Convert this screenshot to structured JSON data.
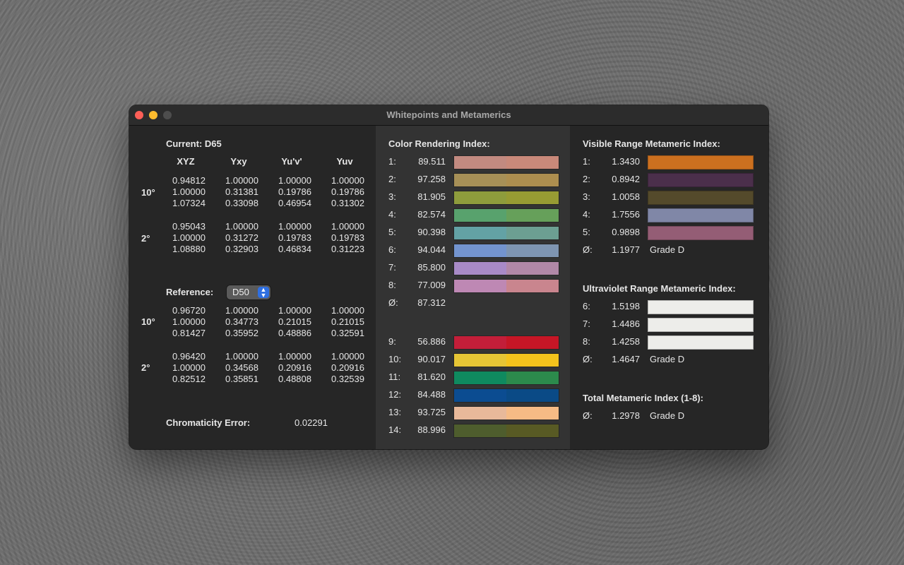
{
  "window": {
    "title": "Whitepoints and Metamerics"
  },
  "left": {
    "current_label": "Current: D65",
    "columns": [
      "XYZ",
      "Yxy",
      "Yu'v'",
      "Yuv"
    ],
    "current": {
      "obs10": {
        "label": "10°",
        "rows": [
          [
            "0.94812",
            "1.00000",
            "1.00000",
            "1.00000"
          ],
          [
            "1.00000",
            "0.31381",
            "0.19786",
            "0.19786"
          ],
          [
            "1.07324",
            "0.33098",
            "0.46954",
            "0.31302"
          ]
        ]
      },
      "obs2": {
        "label": "2°",
        "rows": [
          [
            "0.95043",
            "1.00000",
            "1.00000",
            "1.00000"
          ],
          [
            "1.00000",
            "0.31272",
            "0.19783",
            "0.19783"
          ],
          [
            "1.08880",
            "0.32903",
            "0.46834",
            "0.31223"
          ]
        ]
      }
    },
    "reference_label": "Reference:",
    "reference_value": "D50",
    "reference": {
      "obs10": {
        "label": "10°",
        "rows": [
          [
            "0.96720",
            "1.00000",
            "1.00000",
            "1.00000"
          ],
          [
            "1.00000",
            "0.34773",
            "0.21015",
            "0.21015"
          ],
          [
            "0.81427",
            "0.35952",
            "0.48886",
            "0.32591"
          ]
        ]
      },
      "obs2": {
        "label": "2°",
        "rows": [
          [
            "0.96420",
            "1.00000",
            "1.00000",
            "1.00000"
          ],
          [
            "1.00000",
            "0.34568",
            "0.20916",
            "0.20916"
          ],
          [
            "0.82512",
            "0.35851",
            "0.48808",
            "0.32539"
          ]
        ]
      }
    },
    "chromaticity_label": "Chromaticity Error:",
    "chromaticity_value": "0.02291"
  },
  "cri": {
    "heading": "Color Rendering Index:",
    "items": [
      {
        "label": "1:",
        "value": "89.511",
        "c1": "#c28a80",
        "c2": "#c9897a"
      },
      {
        "label": "2:",
        "value": "97.258",
        "c1": "#a79057",
        "c2": "#ad8e4f"
      },
      {
        "label": "3:",
        "value": "81.905",
        "c1": "#8e9c3c",
        "c2": "#979b33"
      },
      {
        "label": "4:",
        "value": "82.574",
        "c1": "#58a26d",
        "c2": "#66a05a"
      },
      {
        "label": "5:",
        "value": "90.398",
        "c1": "#63a2a5",
        "c2": "#6c9f92"
      },
      {
        "label": "6:",
        "value": "94.044",
        "c1": "#7394cf",
        "c2": "#7e95b2"
      },
      {
        "label": "7:",
        "value": "85.800",
        "c1": "#a88ac7",
        "c2": "#b188a7"
      },
      {
        "label": "8:",
        "value": "77.009",
        "c1": "#be88b4",
        "c2": "#c9858e"
      }
    ],
    "avg_label": "Ø:",
    "avg_value": "87.312",
    "items2": [
      {
        "label": "9:",
        "value": "56.886",
        "c1": "#c31e39",
        "c2": "#c61626"
      },
      {
        "label": "10:",
        "value": "90.017",
        "c1": "#e6c535",
        "c2": "#f4c31c"
      },
      {
        "label": "11:",
        "value": "81.620",
        "c1": "#0f8a5f",
        "c2": "#2c8a4c"
      },
      {
        "label": "12:",
        "value": "84.488",
        "c1": "#0b4c91",
        "c2": "#0a4a86"
      },
      {
        "label": "13:",
        "value": "93.725",
        "c1": "#e8b99a",
        "c2": "#f6bb85"
      },
      {
        "label": "14:",
        "value": "88.996",
        "c1": "#4e5d2d",
        "c2": "#585a24"
      }
    ]
  },
  "visible_mi": {
    "heading": "Visible Range Metameric Index:",
    "items": [
      {
        "label": "1:",
        "value": "1.3430",
        "color": "#cc701f"
      },
      {
        "label": "2:",
        "value": "0.8942",
        "color": "#4b2f4b"
      },
      {
        "label": "3:",
        "value": "1.0058",
        "color": "#544a2b"
      },
      {
        "label": "4:",
        "value": "1.7556",
        "color": "#8087a7"
      },
      {
        "label": "5:",
        "value": "0.9898",
        "color": "#945d75"
      }
    ],
    "avg_label": "Ø:",
    "avg_value": "1.1977",
    "grade": "Grade D"
  },
  "uv_mi": {
    "heading": "Ultraviolet Range Metameric Index:",
    "items": [
      {
        "label": "6:",
        "value": "1.5198",
        "color": "#ededea"
      },
      {
        "label": "7:",
        "value": "1.4486",
        "color": "#ededea"
      },
      {
        "label": "8:",
        "value": "1.4258",
        "color": "#ededea"
      }
    ],
    "avg_label": "Ø:",
    "avg_value": "1.4647",
    "grade": "Grade D"
  },
  "total_mi": {
    "heading": "Total Metameric Index (1-8):",
    "avg_label": "Ø:",
    "avg_value": "1.2978",
    "grade": "Grade D"
  }
}
